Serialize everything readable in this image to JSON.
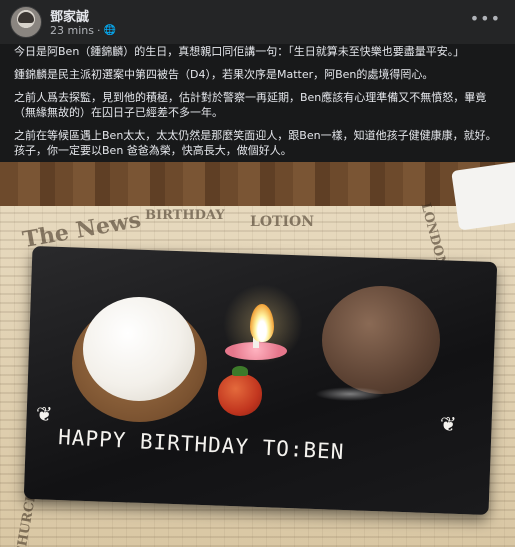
{
  "post": {
    "author": "鄧家誠",
    "time": "23 mins",
    "privacy_icon": "globe-icon",
    "more_icon": "more-options-icon",
    "paragraphs": [
      "今日是阿Ben（鍾錦麟）的生日，真想親口同佢講一句：「生日就算未至快樂也要盡量平安。」",
      "鍾錦麟是民主派初選案中第四被告（D4），若果次序是Matter，阿Ben的處境得罔心。",
      "之前人爲去探監，見到他的積極，估計對於警察一再延期，Ben應該有心理準備又不無憤怒，畢竟（無緣無故的）在囚日子已經差不多一年。",
      "之前在等候區遇上Ben太太，太太仍然是那麼笑面迎人，跟Ben一樣，知道他孩子健健康康，就好。孩子，你一定要以Ben 爸爸為榮，快高長大，做個好人。"
    ]
  },
  "photo": {
    "chalk_text": "HAPPY BIRTHDAY TO:BEN",
    "paper_words": [
      "The News",
      "BIRTHDAY",
      "LOTION",
      "CHURCH FETE UPDATE",
      "LONDON"
    ]
  }
}
